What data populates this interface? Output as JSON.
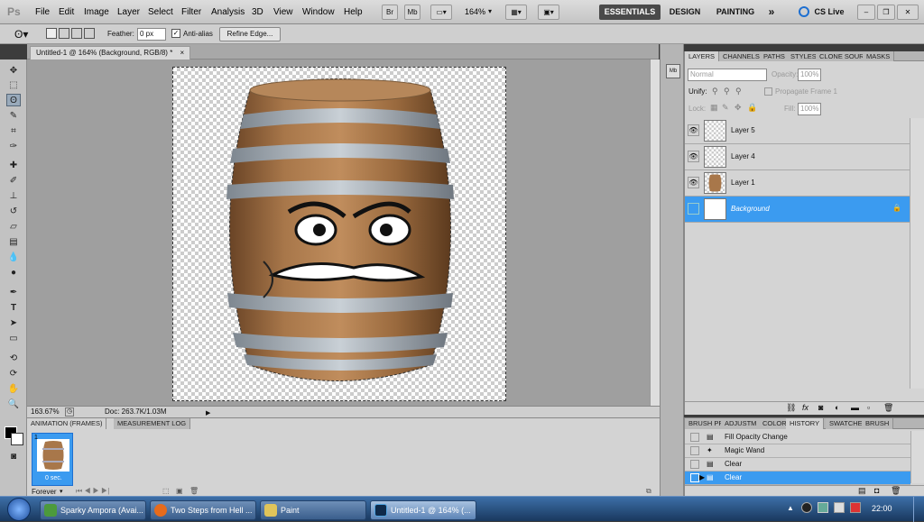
{
  "app": {
    "logo": "Ps"
  },
  "menu": [
    "File",
    "Edit",
    "Image",
    "Layer",
    "Select",
    "Filter",
    "Analysis",
    "3D",
    "View",
    "Window",
    "Help"
  ],
  "appbar": {
    "br": "Br",
    "mb": "Mb",
    "zoom": "164%"
  },
  "workspaces": {
    "essentials": "ESSENTIALS",
    "design": "DESIGN",
    "painting": "PAINTING",
    "more": "»",
    "cslive": "CS Live"
  },
  "options": {
    "feather_label": "Feather:",
    "feather_value": "0 px",
    "antialias_label": "Anti-alias",
    "refine_edge": "Refine Edge..."
  },
  "document": {
    "tab_title": "Untitled-1 @ 164% (Background, RGB/8) *",
    "zoom": "163.67%",
    "doc_info": "Doc: 263.7K/1.03M"
  },
  "anim_panel": {
    "tabs": [
      "ANIMATION (FRAMES)",
      "MEASUREMENT LOG"
    ],
    "frame_number": "1",
    "frame_delay": "0 sec.",
    "loop": "Forever"
  },
  "layers_panel": {
    "tabs": [
      "LAYERS",
      "CHANNELS",
      "PATHS",
      "STYLES",
      "CLONE SOURCE",
      "MASKS"
    ],
    "blend_mode": "Normal",
    "opacity_label": "Opacity:",
    "opacity_value": "100%",
    "unify_label": "Unify:",
    "propagate_label": "Propagate Frame 1",
    "lock_label": "Lock:",
    "fill_label": "Fill:",
    "fill_value": "100%",
    "layers": [
      {
        "name": "Layer 5",
        "visible": true,
        "selected": false
      },
      {
        "name": "Layer 4",
        "visible": true,
        "selected": false
      },
      {
        "name": "Layer 1",
        "visible": true,
        "selected": false
      },
      {
        "name": "Background",
        "visible": false,
        "selected": true
      }
    ]
  },
  "history_panel": {
    "tabs": [
      "BRUSH PR",
      "ADJUSTM",
      "COLOR",
      "HISTORY",
      "SWATCHE",
      "BRUSH"
    ],
    "items": [
      {
        "name": "Fill Opacity Change",
        "selected": false
      },
      {
        "name": "Magic Wand",
        "selected": false
      },
      {
        "name": "Clear",
        "selected": false
      },
      {
        "name": "Clear",
        "selected": true
      }
    ]
  },
  "taskbar": {
    "items": [
      "Sparky Ampora (Avai...",
      "Two Steps from Hell ...",
      "Paint",
      "Untitled-1 @ 164% (..."
    ],
    "clock": "22:00"
  }
}
